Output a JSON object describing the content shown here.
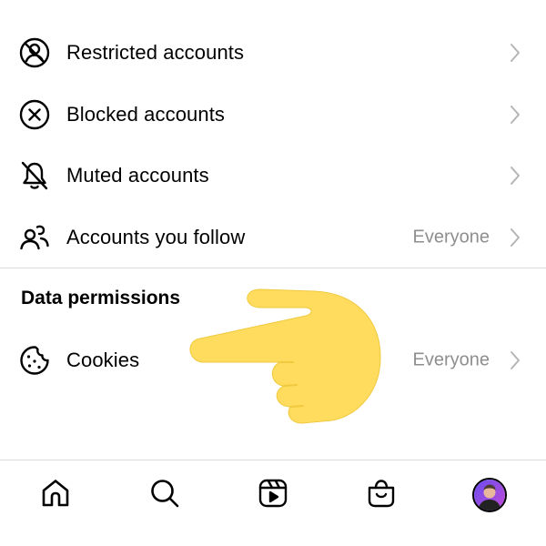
{
  "settings_list": [
    {
      "label": "Restricted accounts",
      "icon": "restricted-icon",
      "value": ""
    },
    {
      "label": "Blocked accounts",
      "icon": "blocked-icon",
      "value": ""
    },
    {
      "label": "Muted accounts",
      "icon": "muted-bell-icon",
      "value": ""
    },
    {
      "label": "Accounts you follow",
      "icon": "people-icon",
      "value": "Everyone"
    }
  ],
  "data_permissions": {
    "title": "Data permissions",
    "items": [
      {
        "label": "Cookies",
        "icon": "cookie-icon",
        "value": "Everyone"
      }
    ]
  },
  "tab_bar": {
    "items": [
      "home-icon",
      "search-icon",
      "reels-icon",
      "shop-icon",
      "profile-avatar"
    ]
  },
  "colors": {
    "text": "#000000",
    "secondary_text": "#8e8e8e",
    "divider": "#dbdbdb",
    "pointer_hand": "#ffdc5d"
  }
}
